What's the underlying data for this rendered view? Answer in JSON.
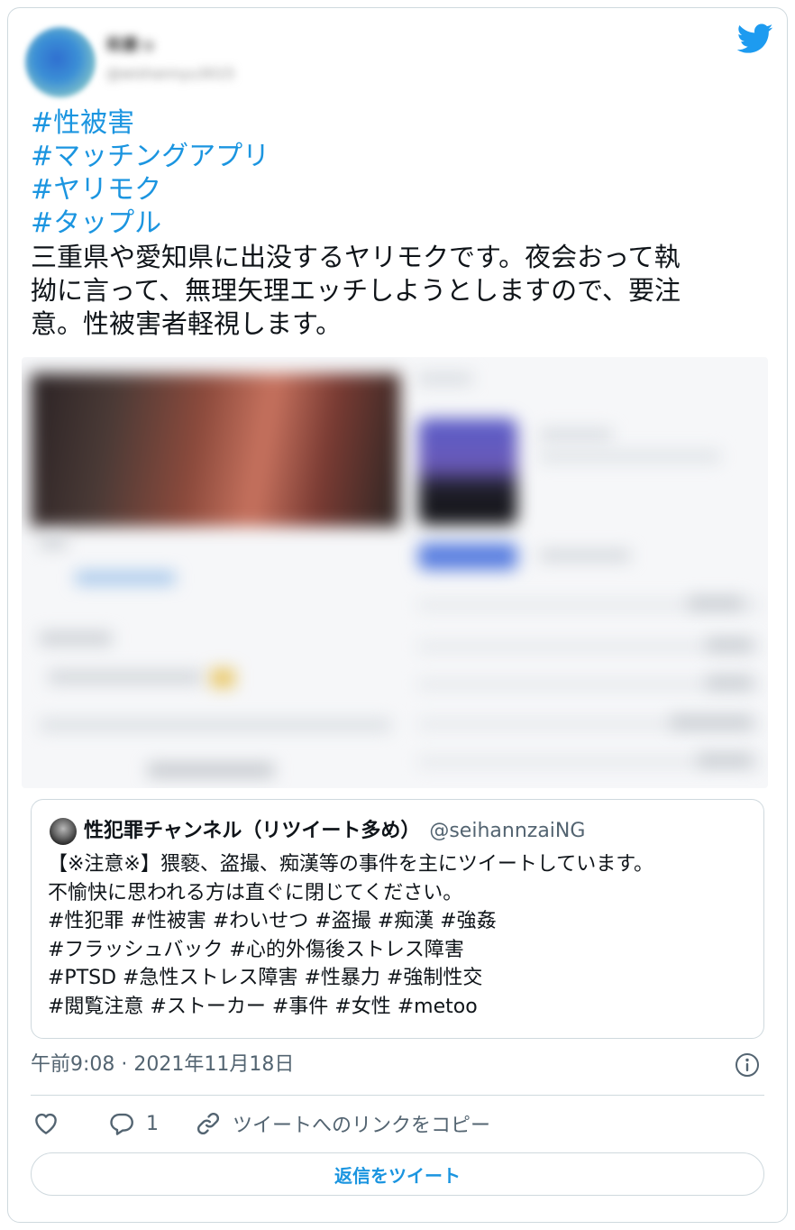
{
  "author": {
    "name": "和素っ",
    "handle": "@wishannyu3015"
  },
  "hashtags": [
    "#性被害",
    "#マッチングアプリ",
    "#ヤリモク",
    "#タップル"
  ],
  "body_lines": [
    "三重県や愛知県に出没するヤリモクです。夜会おって執",
    "拗に言って、無理矢理エッチしようとしますので、要注",
    "意。性被害者軽視します。"
  ],
  "quote": {
    "name": "性犯罪チャンネル（リツイート多め）",
    "handle": "@seihannzaiNG",
    "lines": [
      "【※注意※】猥褻、盗撮、痴漢等の事件を主にツイートしています。",
      "不愉快に思われる方は直ぐに閉じてください。",
      "#性犯罪 #性被害 #わいせつ #盗撮 #痴漢 #強姦",
      "#フラッシュバック #心的外傷後ストレス障害",
      "#PTSD #急性ストレス障害 #性暴力 #強制性交",
      "#閲覧注意 #ストーカー #事件 #女性 #metoo"
    ]
  },
  "timestamp": "午前9:08 · 2021年11月18日",
  "actions": {
    "reply_count": "1",
    "copy_link": "ツイートへのリンクをコピー"
  },
  "reply_button": "返信をツイート",
  "colors": {
    "accent": "#1b95e0",
    "text": "#0f1419",
    "muted": "#536471",
    "border": "#cfd9de"
  }
}
